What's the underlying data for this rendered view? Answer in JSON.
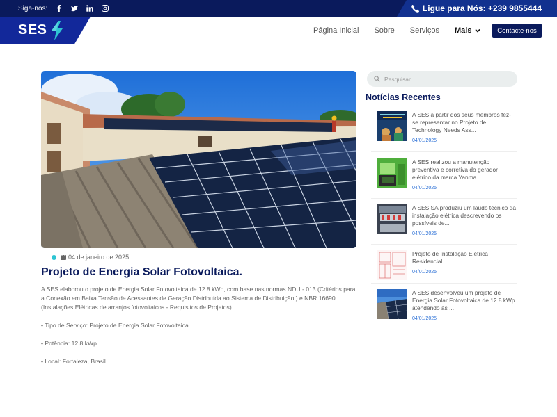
{
  "topbar": {
    "follow_label": "Siga-nos:",
    "social_icons": [
      "facebook-icon",
      "twitter-icon",
      "linkedin-icon",
      "instagram-icon"
    ],
    "phone_label": "Ligue para Nós: +239 9855444"
  },
  "header": {
    "logo_text": "SES",
    "nav": [
      "Página Inicial",
      "Sobre",
      "Serviços"
    ],
    "more_label": "Mais",
    "contact_button": "Contacte-nos"
  },
  "post": {
    "date": "04 de janeiro de 2025",
    "title": "Projeto de Energia Solar Fotovoltaica.",
    "paragraphs": [
      "A SES elaborou o projeto de Energia Solar Fotovoltaica de 12.8 kWp, com base nas normas NDU - 013 (Critérios para a Conexão em Baixa Tensão de Acessantes de Geração Distribuída ao Sistema de Distribuição ) e NBR 16690 (Instalações Elétricas de arranjos fotovoltaicos - Requisitos de Projetos)",
      "• Tipo de Serviço: Projeto de Energia Solar Fotovoltaica.",
      "• Potência: 12.8 kWp.",
      "• Local: Fortaleza, Brasil."
    ]
  },
  "sidebar": {
    "search_placeholder": "Pesquisar",
    "recent_title": "Notícias Recentes",
    "news": [
      {
        "title": "A SES a partir dos seus membros fez-se representar no Projeto de Technology Needs Ass...",
        "date": "04/01/2025"
      },
      {
        "title": "A SES realizou a manutenção preventiva e corretiva do gerador elétrico da marca Yanma...",
        "date": "04/01/2025"
      },
      {
        "title": "A SES SA produziu um laudo técnico da instalação elétrica descrevendo os possíveis de...",
        "date": "04/01/2025"
      },
      {
        "title": "Projeto de Instalação Elétrica Residencial",
        "date": "04/01/2025"
      },
      {
        "title": "A SES desenvolveu um projeto de Energia Solar Fotovoltaica de 12.8 kWp. atendendo às ...",
        "date": "04/01/2025"
      }
    ]
  },
  "colors": {
    "navy": "#0a1a5c",
    "brand_blue": "#12289a",
    "accent_cyan": "#2ec5d3",
    "date_blue": "#2a6fd6"
  }
}
